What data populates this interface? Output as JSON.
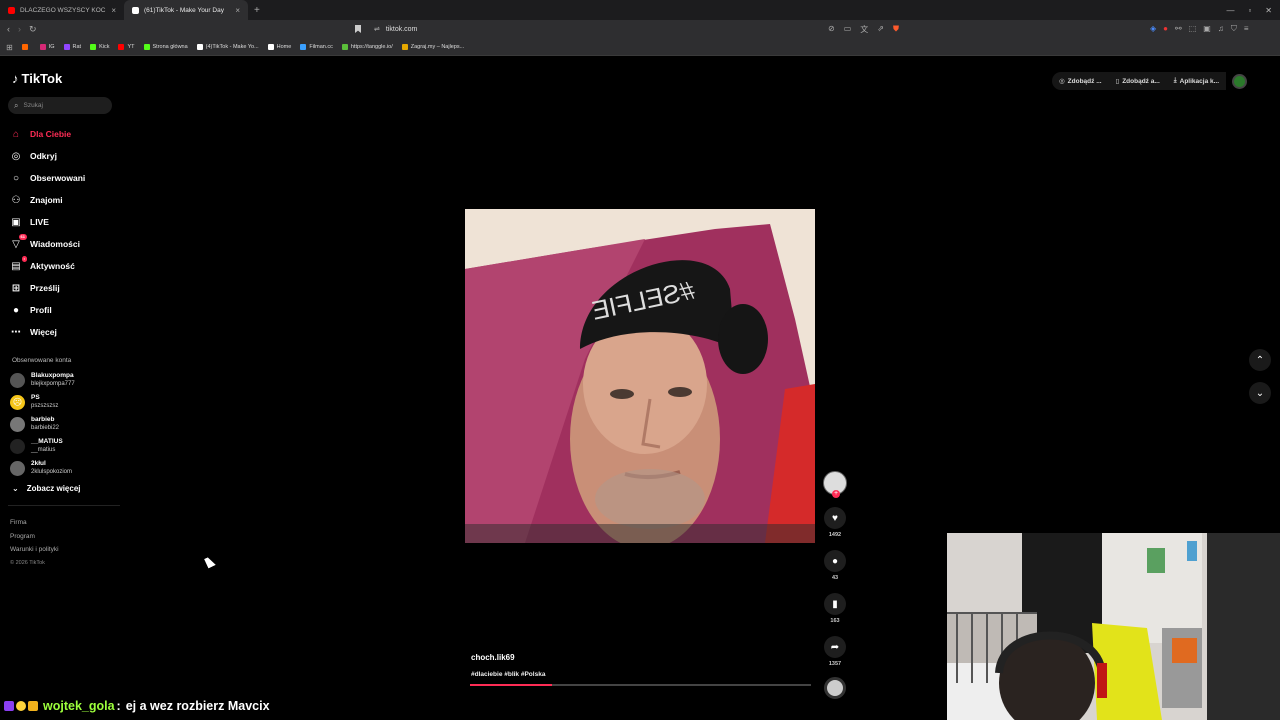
{
  "browser": {
    "tabs": [
      {
        "title": "DLACZEGO WSZYSCY KOCHAJĄ MA",
        "color": "#ff0000",
        "active": false
      },
      {
        "title": "(61)TikTok - Make Your Day",
        "color": "#ffffff",
        "active": true
      }
    ],
    "new_tab": "+",
    "url": "tiktok.com",
    "bookmarks": [
      {
        "label": "",
        "color": "#ff6600"
      },
      {
        "label": "IG",
        "color": "#d62976"
      },
      {
        "label": "Rat",
        "color": "#9146ff"
      },
      {
        "label": "Kick",
        "color": "#53fc18"
      },
      {
        "label": "YT",
        "color": "#ff0000"
      },
      {
        "label": "Strona główna",
        "color": "#53fc18"
      },
      {
        "label": "(4)TikTok - Make Yo...",
        "color": "#ffffff"
      },
      {
        "label": "Home",
        "color": "#ffffff"
      },
      {
        "label": "Filman.cc",
        "color": "#3aa0ff"
      },
      {
        "label": "https://tanggle.io/",
        "color": "#5bbf3a"
      },
      {
        "label": "Zagraj.my – Najleps...",
        "color": "#e6a800"
      }
    ]
  },
  "tiktok": {
    "logo": "TikTok",
    "search_placeholder": "Szukaj",
    "nav": [
      {
        "label": "Dla Ciebie",
        "icon": "home-icon",
        "glyph": "⌂",
        "active": true,
        "badge": ""
      },
      {
        "label": "Odkryj",
        "icon": "compass-icon",
        "glyph": "◎",
        "active": false,
        "badge": ""
      },
      {
        "label": "Obserwowani",
        "icon": "following-icon",
        "glyph": "○",
        "active": false,
        "badge": ""
      },
      {
        "label": "Znajomi",
        "icon": "friends-icon",
        "glyph": "⚇",
        "active": false,
        "badge": ""
      },
      {
        "label": "LIVE",
        "icon": "live-icon",
        "glyph": "▣",
        "active": false,
        "badge": ""
      },
      {
        "label": "Wiadomości",
        "icon": "messages-icon",
        "glyph": "▽",
        "active": false,
        "badge": "61"
      },
      {
        "label": "Aktywność",
        "icon": "activity-icon",
        "glyph": "▤",
        "active": false,
        "badge": "•"
      },
      {
        "label": "Prześlij",
        "icon": "upload-icon",
        "glyph": "⊞",
        "active": false,
        "badge": ""
      },
      {
        "label": "Profil",
        "icon": "profile-icon",
        "glyph": "●",
        "active": false,
        "badge": ""
      },
      {
        "label": "Więcej",
        "icon": "more-icon",
        "glyph": "⋯",
        "active": false,
        "badge": ""
      }
    ],
    "followed_title": "Obserwowane konta",
    "followed": [
      {
        "name": "Blakuxpompa",
        "user": "blejkxpompa777",
        "color": "#555555",
        "glyph": ""
      },
      {
        "name": "PS",
        "user": "pszszszsz",
        "color": "#f5c518",
        "glyph": "☹"
      },
      {
        "name": "barbieb",
        "user": "barbiebi22",
        "color": "#777777",
        "glyph": ""
      },
      {
        "name": "__MATIUS",
        "user": "__matius",
        "color": "#222222",
        "glyph": ""
      },
      {
        "name": "2kłul",
        "user": "2klulspokoziom",
        "color": "#666666",
        "glyph": ""
      }
    ],
    "see_more": "Zobacz więcej",
    "footer": [
      "Firma",
      "Program",
      "Warunki i polityki"
    ],
    "copyright": "© 2026 TikTok",
    "top_actions": [
      "Zdobądź ...",
      "Zdobądź a...",
      "Aplikacja k..."
    ],
    "video": {
      "author": "choch.lik69",
      "tags": "#dlaciebie #blik #Polska",
      "progress": 0.24,
      "hat_text": "#SELFIE"
    },
    "counts": {
      "likes": "1492",
      "comments": "43",
      "saves": "163",
      "shares": "1357"
    }
  },
  "chat": {
    "user": "wojtek_gola",
    "separator": ":",
    "message": "ej a wez rozbierz Mavcix"
  }
}
